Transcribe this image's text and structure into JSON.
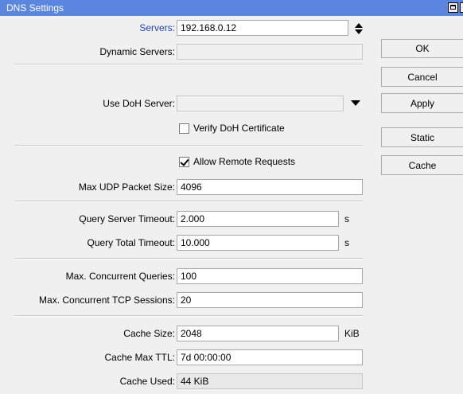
{
  "window": {
    "title": "DNS Settings"
  },
  "servers": {
    "label": "Servers:",
    "value": "192.168.0.12"
  },
  "dynamic_servers": {
    "label": "Dynamic Servers:",
    "value": ""
  },
  "use_doh_server": {
    "label": "Use DoH Server:",
    "value": ""
  },
  "verify_doh_certificate": {
    "label": "Verify DoH Certificate",
    "checked": false
  },
  "allow_remote_requests": {
    "label": "Allow Remote Requests",
    "checked": true
  },
  "max_udp_packet_size": {
    "label": "Max UDP Packet Size:",
    "value": "4096"
  },
  "query_server_timeout": {
    "label": "Query Server Timeout:",
    "value": "2.000",
    "unit": "s"
  },
  "query_total_timeout": {
    "label": "Query Total Timeout:",
    "value": "10.000",
    "unit": "s"
  },
  "max_concurrent_queries": {
    "label": "Max. Concurrent Queries:",
    "value": "100"
  },
  "max_concurrent_tcp_sessions": {
    "label": "Max. Concurrent TCP Sessions:",
    "value": "20"
  },
  "cache_size": {
    "label": "Cache Size:",
    "value": "2048",
    "unit": "KiB"
  },
  "cache_max_ttl": {
    "label": "Cache Max TTL:",
    "value": "7d 00:00:00"
  },
  "cache_used": {
    "label": "Cache Used:",
    "value": "44 KiB"
  },
  "buttons": {
    "ok": "OK",
    "cancel": "Cancel",
    "apply": "Apply",
    "static": "Static",
    "cache": "Cache"
  },
  "colors": {
    "titlebar": "#5b86e0",
    "label_highlight": "#1f3fbf"
  }
}
